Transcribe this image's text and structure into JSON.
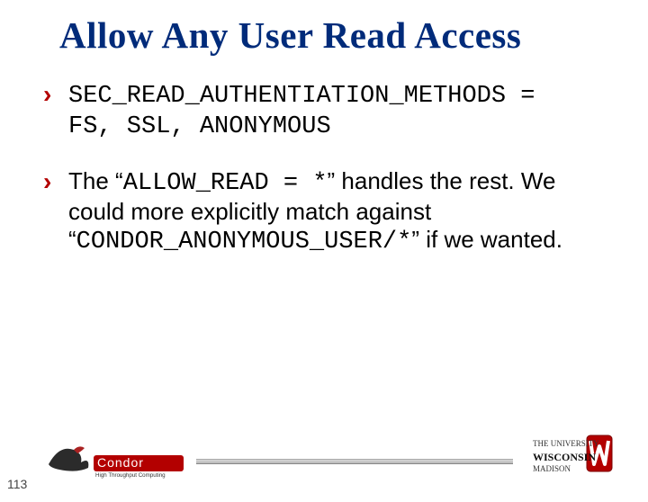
{
  "title": "Allow Any User Read Access",
  "bullets": {
    "b1_code1": "SEC_READ_AUTHENTIATION_METHODS =",
    "b1_code2": "FS, SSL, ANONYMOUS",
    "b2_pre": "The “",
    "b2_code1": "ALLOW_READ = *",
    "b2_mid1": "” handles the rest. We could more explicitly match against “",
    "b2_code2": "CONDOR_ANONYMOUS_USER/*",
    "b2_mid2": "” if we wanted."
  },
  "page_number": "113",
  "condor_name": "Condor",
  "condor_tagline": "High Throughput Computing",
  "crest_top": "THE UNIVERSITY",
  "crest_name": "WISCONSIN",
  "crest_bottom": "MADISON"
}
